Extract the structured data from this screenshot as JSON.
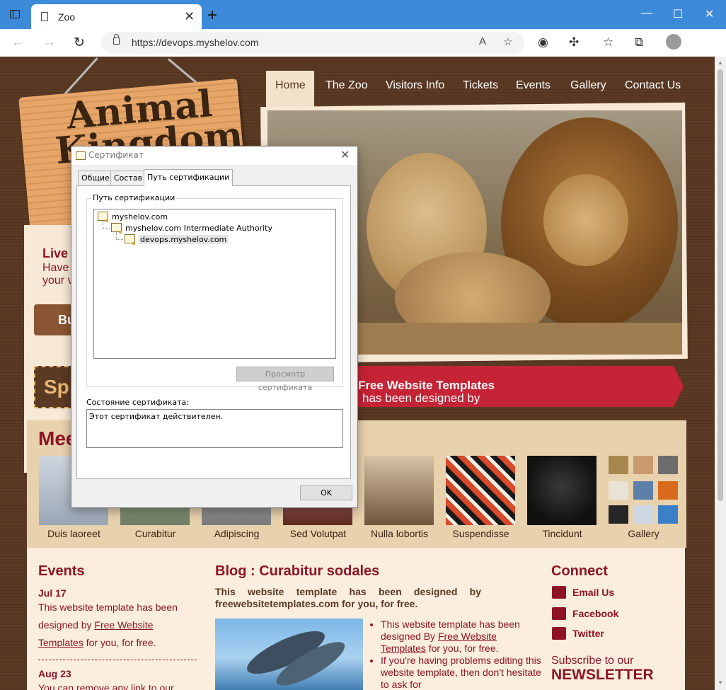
{
  "browser": {
    "tab_title": "Zoo",
    "url": "https://devops.myshelov.com"
  },
  "site": {
    "nav": [
      "Home",
      "The Zoo",
      "Visitors Info",
      "Tickets",
      "Events",
      "Gallery",
      "Contact Us"
    ],
    "logo": {
      "line1": "Animal",
      "line2": "Kingdom"
    },
    "live": {
      "title": "Live",
      "line1": "Have",
      "line2": "your v"
    },
    "buy_label": "Bu",
    "special_label": "Sp",
    "banner": {
      "text": "has been designed by ",
      "bold": "Free Website Templates"
    },
    "meet_title": "Mee",
    "animals": [
      "Duis laoreet",
      "Curabitur",
      "Adipiscing",
      "Sed Volutpat",
      "Nulla lobortis",
      "Suspendisse",
      "Tincidunt",
      "Gallery"
    ],
    "events": {
      "title": "Events",
      "items": [
        {
          "date": "Jul 17",
          "text_pre": "This website template has been designed by ",
          "link": "Free Website Templates",
          "text_post": " for you, for free."
        },
        {
          "date": "Aug 23",
          "text_pre": "You can remove any link to our",
          "link": "",
          "text_post": ""
        }
      ]
    },
    "blog": {
      "title": "Blog : Curabitur sodales",
      "intro": "This website template has been designed by freewebsitetemplates.com for you, for free.",
      "list": [
        {
          "pre": "This website template has been designed By ",
          "link": "Free Website Templates",
          "post": " for you, for free."
        },
        {
          "pre": "If you're having problems editing this website template, then don't hesitate to ask for",
          "link": "",
          "post": ""
        }
      ]
    },
    "connect": {
      "title": "Connect",
      "items": [
        "Email Us",
        "Facebook",
        "Twitter"
      ],
      "subscribe": "Subscribe to our",
      "newsletter": "NEWSLETTER"
    }
  },
  "dialog": {
    "title": "Сертификат",
    "tabs": [
      "Общие",
      "Состав",
      "Путь сертификации"
    ],
    "active_tab": "Путь сертификации",
    "group_label": "Путь сертификации",
    "tree": [
      "myshelov.com",
      "myshelov.com Intermediate Authority",
      "devops.myshelov.com"
    ],
    "view_button": "Просмотр сертификата",
    "status_label": "Состояние сертификата:",
    "status_text": "Этот сертификат действителен.",
    "ok": "OK"
  }
}
